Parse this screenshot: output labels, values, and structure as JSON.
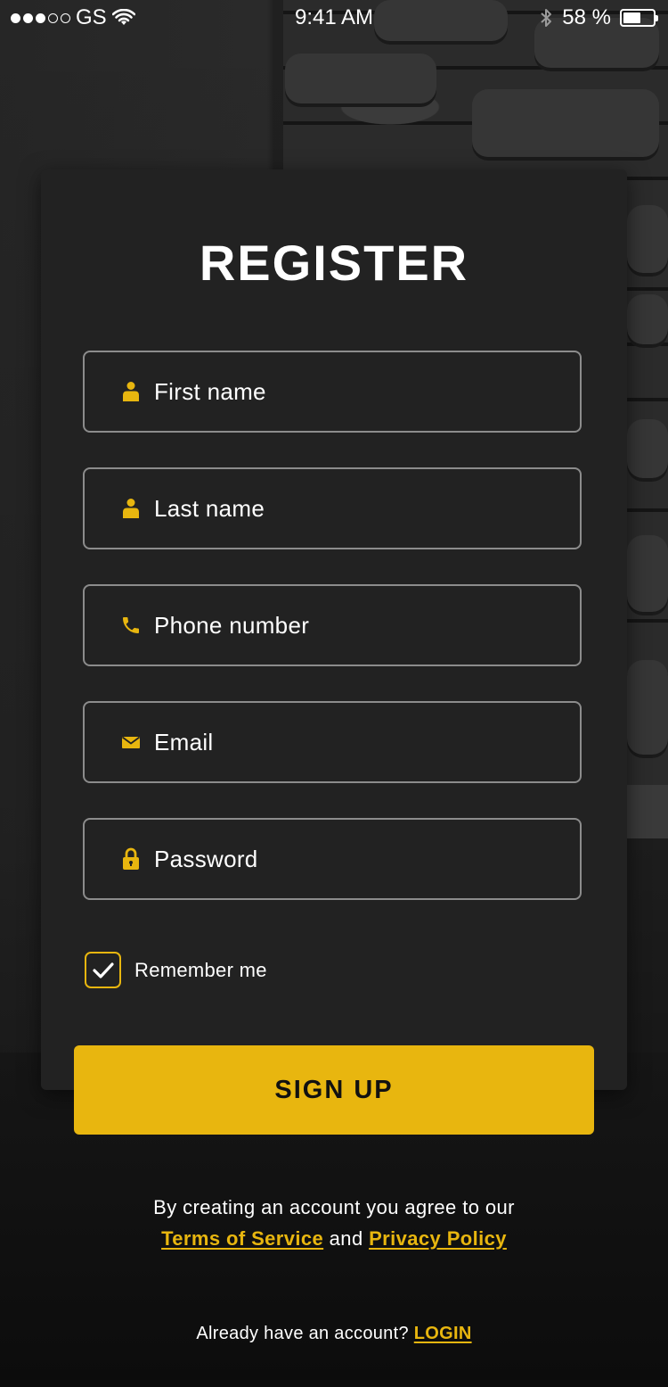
{
  "status_bar": {
    "carrier": "GS",
    "time": "9:41 AM",
    "battery_text": "58 %",
    "battery_level": 0.58
  },
  "form": {
    "title": "REGISTER",
    "fields": [
      {
        "placeholder": "First name",
        "icon": "user-icon"
      },
      {
        "placeholder": "Last name",
        "icon": "user-icon"
      },
      {
        "placeholder": "Phone number",
        "icon": "phone-icon"
      },
      {
        "placeholder": "Email",
        "icon": "envelope-icon"
      },
      {
        "placeholder": "Password",
        "icon": "lock-icon"
      }
    ],
    "remember_label": "Remember me",
    "remember_checked": true,
    "submit_label": "SIGN UP"
  },
  "legal": {
    "prefix": "By creating an account you agree to our",
    "terms_link": "Terms of Service",
    "joiner": "and",
    "privacy_link": "Privacy Policy"
  },
  "footer": {
    "prompt": "Already have an account?",
    "login_link": "LOGIN"
  },
  "colors": {
    "accent": "#e8b60f",
    "card": "#222222",
    "field_border": "#8c8c8c"
  }
}
